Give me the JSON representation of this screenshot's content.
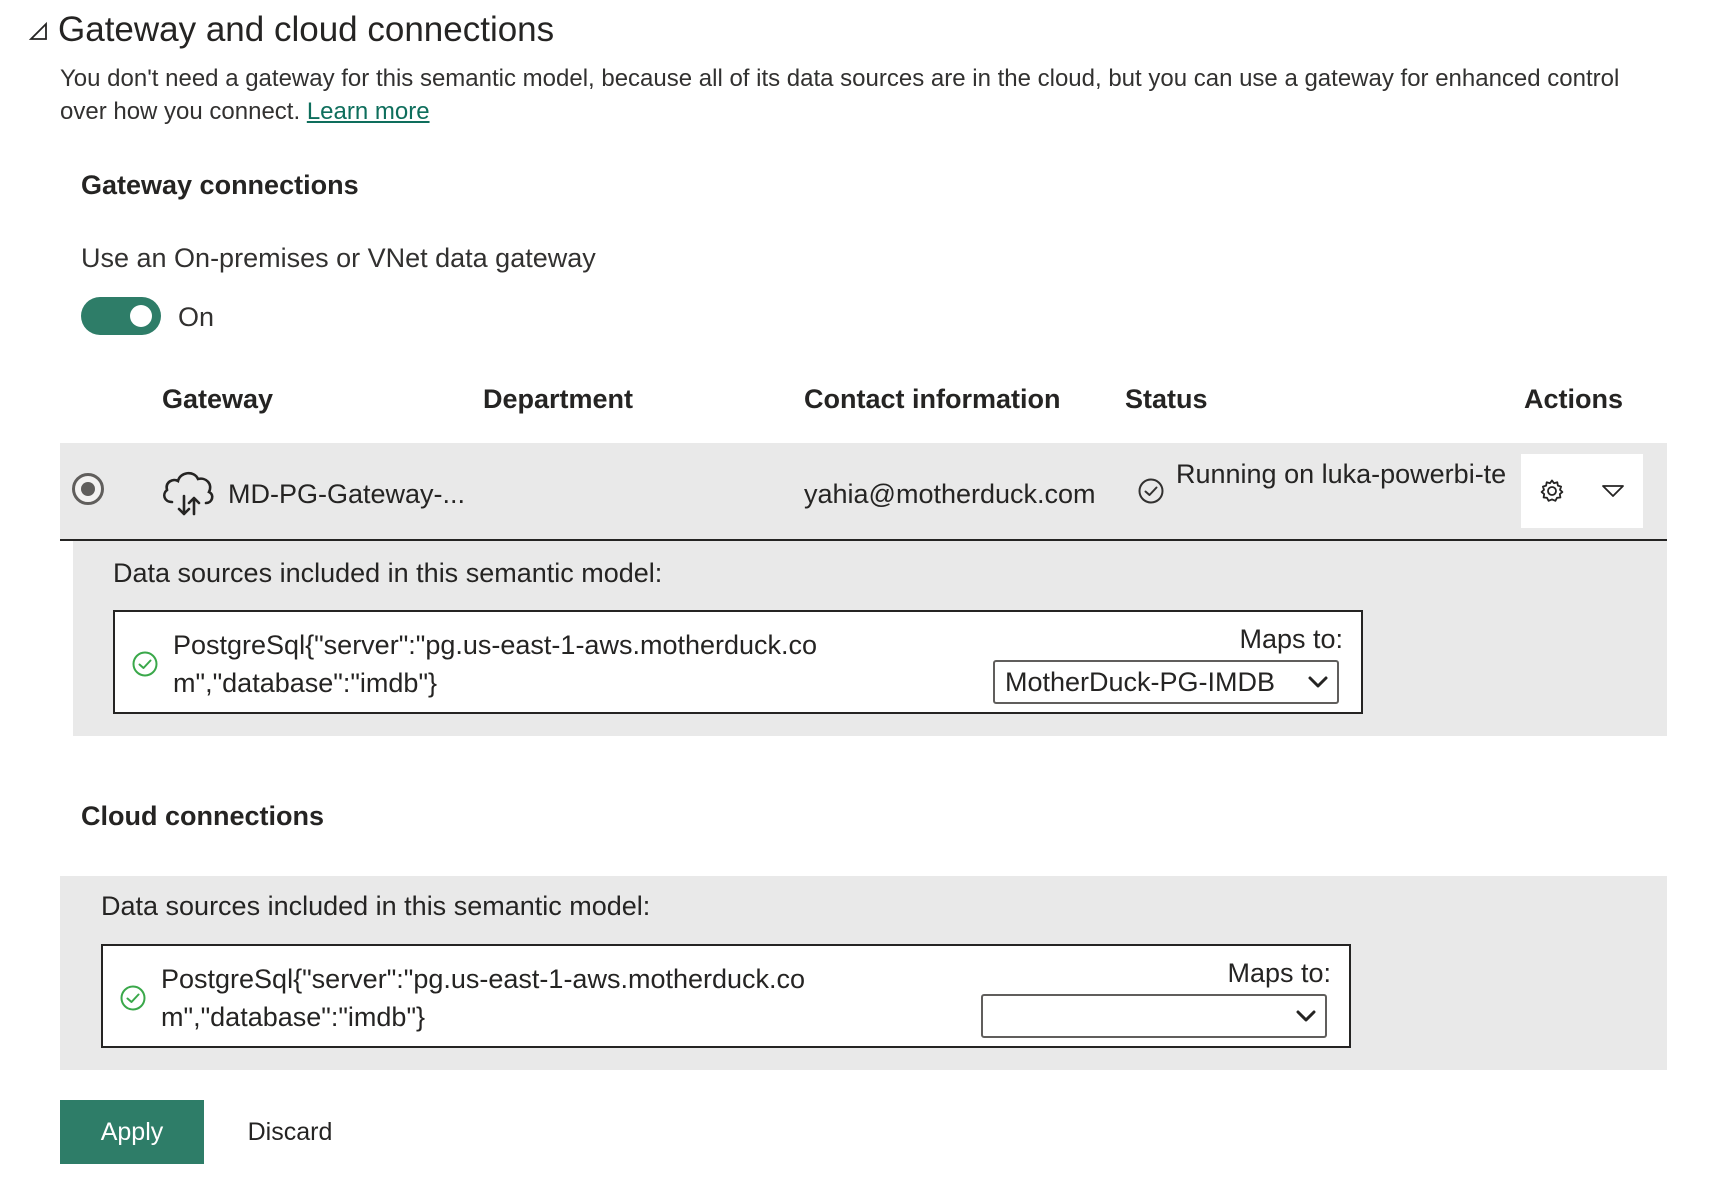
{
  "section": {
    "title": "Gateway and cloud connections",
    "description": "You don't need a gateway for this semantic model, because all of its data sources are in the cloud, but you can use a gateway for enhanced control over how you connect.",
    "learn_more": "Learn more"
  },
  "gateway_connections": {
    "heading": "Gateway connections",
    "toggle_label": "Use an On-premises or VNet data gateway",
    "toggle_state": "On",
    "toggle_on": true,
    "columns": {
      "gateway": "Gateway",
      "department": "Department",
      "contact": "Contact information",
      "status": "Status",
      "actions": "Actions"
    },
    "row": {
      "gateway": "MD-PG-Gateway-...",
      "department": "",
      "contact": "yahia@motherduck.com",
      "status": "Running on luka-powerbi-te",
      "selected": true,
      "gateway_icon": "cloud-upload-download-icon",
      "status_icon": "check-circle-icon",
      "settings_icon": "gear-icon",
      "expand_icon": "chevron-down-icon"
    },
    "data_sources_label": "Data sources included in this semantic model:",
    "data_source": {
      "text": "PostgreSql{\"server\":\"pg.us-east-1-aws.motherduck.com\",\"database\":\"imdb\"}",
      "maps_to_label": "Maps to:",
      "maps_to_value": "MotherDuck-PG-IMDB"
    }
  },
  "cloud_connections": {
    "heading": "Cloud connections",
    "data_sources_label": "Data sources included in this semantic model:",
    "data_source": {
      "text": "PostgreSql{\"server\":\"pg.us-east-1-aws.motherduck.com\",\"database\":\"imdb\"}",
      "maps_to_label": "Maps to:",
      "maps_to_value": ""
    }
  },
  "buttons": {
    "apply": "Apply",
    "discard": "Discard"
  },
  "colors": {
    "accent": "#2e7d68",
    "success": "#3aa84a",
    "panel": "#e9e9e9",
    "link": "#0e6e5c"
  }
}
